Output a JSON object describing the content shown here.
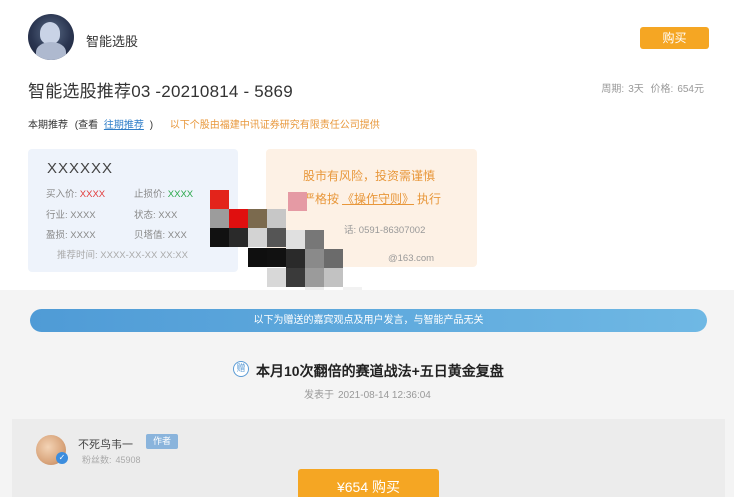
{
  "header": {
    "brand": "智能选股",
    "buy_label": "购买"
  },
  "recommendation": {
    "title": "智能选股推荐03 -20210814 - 5869",
    "period_label": "周期:",
    "period_value": "3天",
    "price_label": "价格:",
    "price_value": "654元"
  },
  "current": {
    "label": "本期推荐",
    "paren_open": "(查看",
    "history_link": "往期推荐",
    "paren_close": ")",
    "provider_note": "以下个股由福建中讯证券研究有限责任公司提供"
  },
  "stock_card": {
    "name": "XXXXXX",
    "buy_label": "买入价:",
    "buy_value": "XXXX",
    "stop_label": "止损价:",
    "stop_value": "XXXX",
    "industry_label": "行业:",
    "industry_value": "XXXX",
    "status_label": "状态:",
    "status_value": "XXX",
    "earnings_label": "盈损:",
    "earnings_value": "XXXX",
    "pb_label": "贝塔值:",
    "pb_value": "XXX",
    "time_label": "推荐时间:",
    "time_value": "XXXX-XX-XX XX:XX"
  },
  "risk_card": {
    "line1": "股市有风险，投资需谨慎",
    "line2_prefix": "请严格按",
    "line2_link": "《操作守则》",
    "line2_suffix": "执行",
    "phone_label": "话:",
    "phone_value": "0591-86307002",
    "email": "@163.com"
  },
  "notice_banner": "以下为赠送的嘉宾观点及用户发言，与智能产品无关",
  "article": {
    "icon_glyph": "赠",
    "title": "本月10次翻倍的赛道战法+五日黄金复盘",
    "published_label": "发表于",
    "published_time": "2021-08-14 12:36:04"
  },
  "author": {
    "name": "不死鸟韦一",
    "tag": "作者",
    "fans_label": "粉丝数:",
    "fans_count": "45908",
    "verified_glyph": "✓"
  },
  "purchase": {
    "label": "¥654  购买"
  },
  "colors": {
    "accent": "#f5a623",
    "link": "#2f7ec8",
    "note": "#e8973a",
    "banner": "#5aa9dd"
  }
}
